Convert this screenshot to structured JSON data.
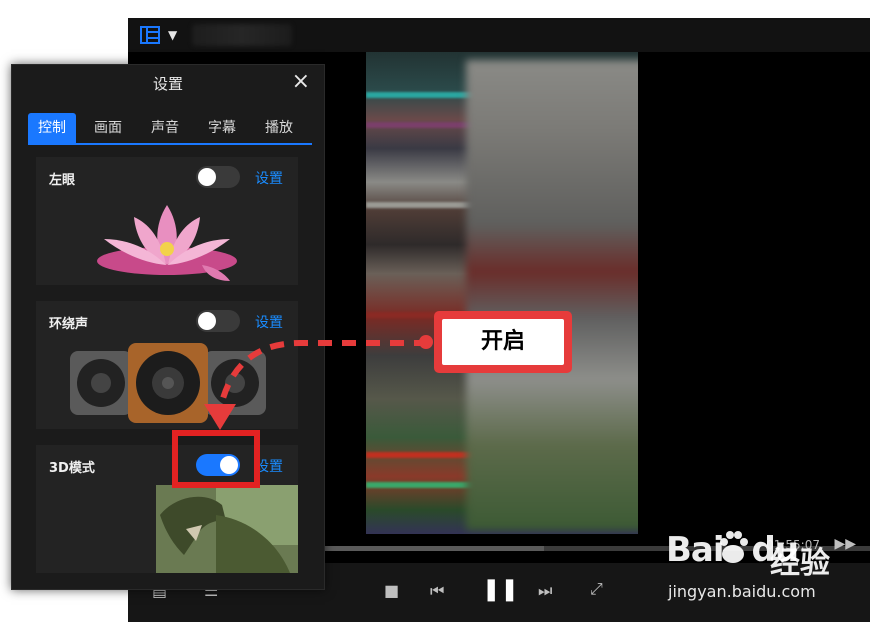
{
  "player": {
    "time": "01:55:07",
    "progress_fraction": 0.56
  },
  "settings": {
    "title": "设置",
    "tabs": [
      {
        "label": "控制",
        "active": true
      },
      {
        "label": "画面",
        "active": false
      },
      {
        "label": "声音",
        "active": false
      },
      {
        "label": "字幕",
        "active": false
      },
      {
        "label": "播放",
        "active": false
      }
    ],
    "cards": [
      {
        "label": "左眼",
        "toggle_on": false,
        "link": "设置"
      },
      {
        "label": "环绕声",
        "toggle_on": false,
        "link": "设置"
      },
      {
        "label": "3D模式",
        "toggle_on": true,
        "link": "设置"
      }
    ]
  },
  "annotation": {
    "label": "开启"
  },
  "watermark": {
    "logo_a": "Bai",
    "logo_b": "du",
    "logo_c": "经验",
    "url": "jingyan.baidu.com"
  },
  "colors": {
    "accent": "#1a78ff",
    "annotation_red": "#e32222"
  }
}
